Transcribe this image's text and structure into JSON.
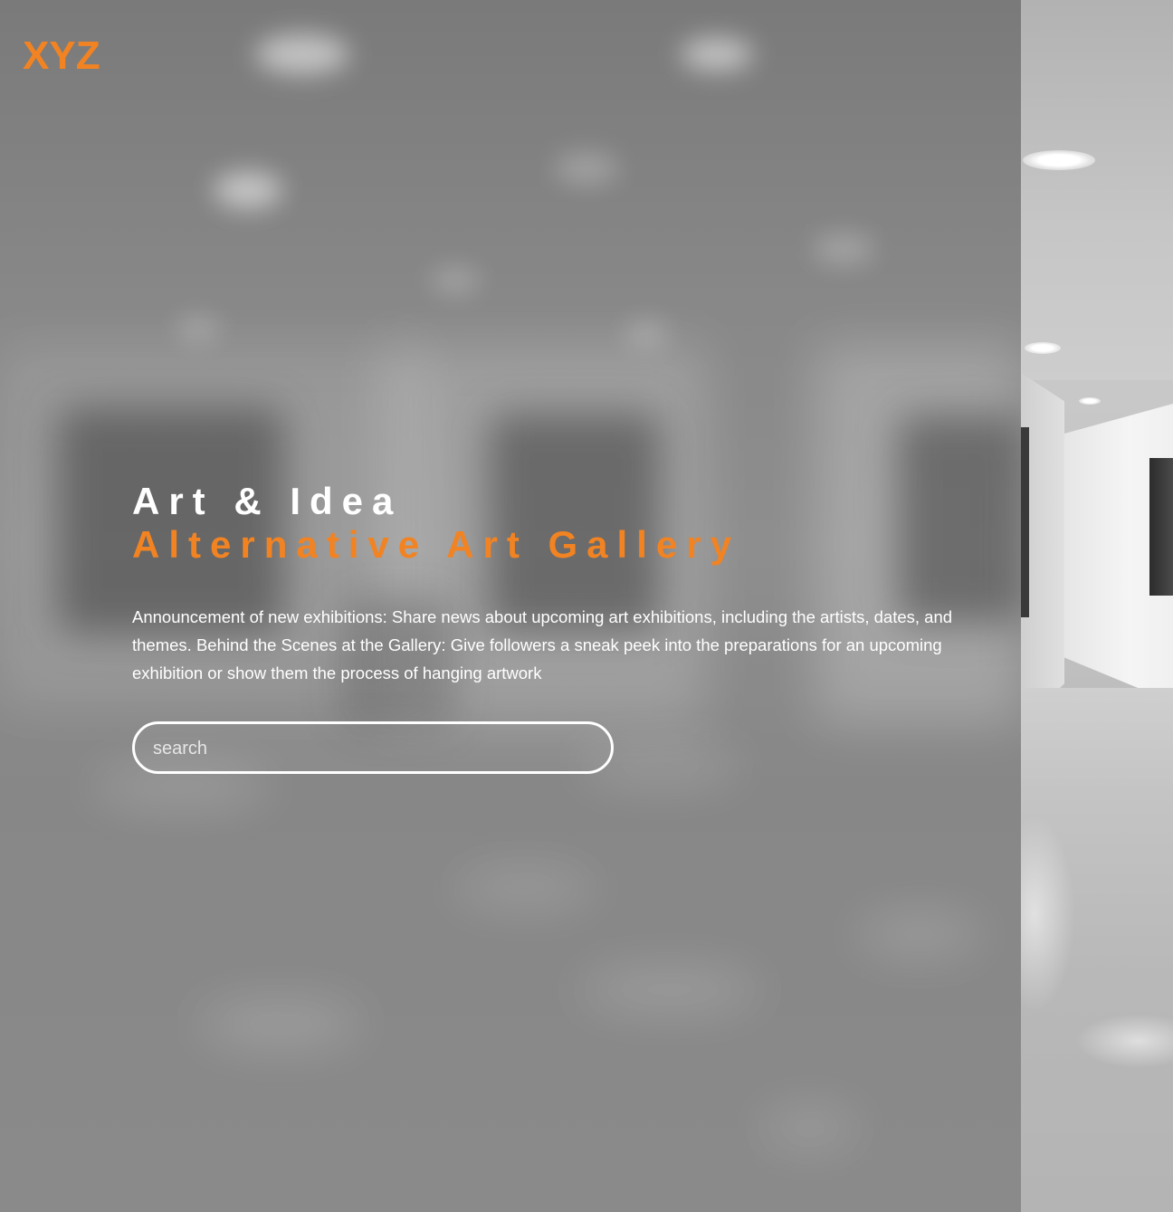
{
  "brand": {
    "logo_text": "XYZ"
  },
  "hero": {
    "title_line1": "Art & Idea",
    "title_line2": "Alternative Art Gallery",
    "description": "Announcement of new exhibitions: Share news about upcoming art exhibitions, including the artists, dates, and themes. Behind the Scenes at the Gallery: Give followers a sneak peek into the preparations for an upcoming exhibition or show them the process of hanging artwork"
  },
  "search": {
    "placeholder": "search",
    "value": ""
  },
  "colors": {
    "accent": "#F28322",
    "text": "#FFFFFF",
    "overlay": "#8A8A8A"
  }
}
